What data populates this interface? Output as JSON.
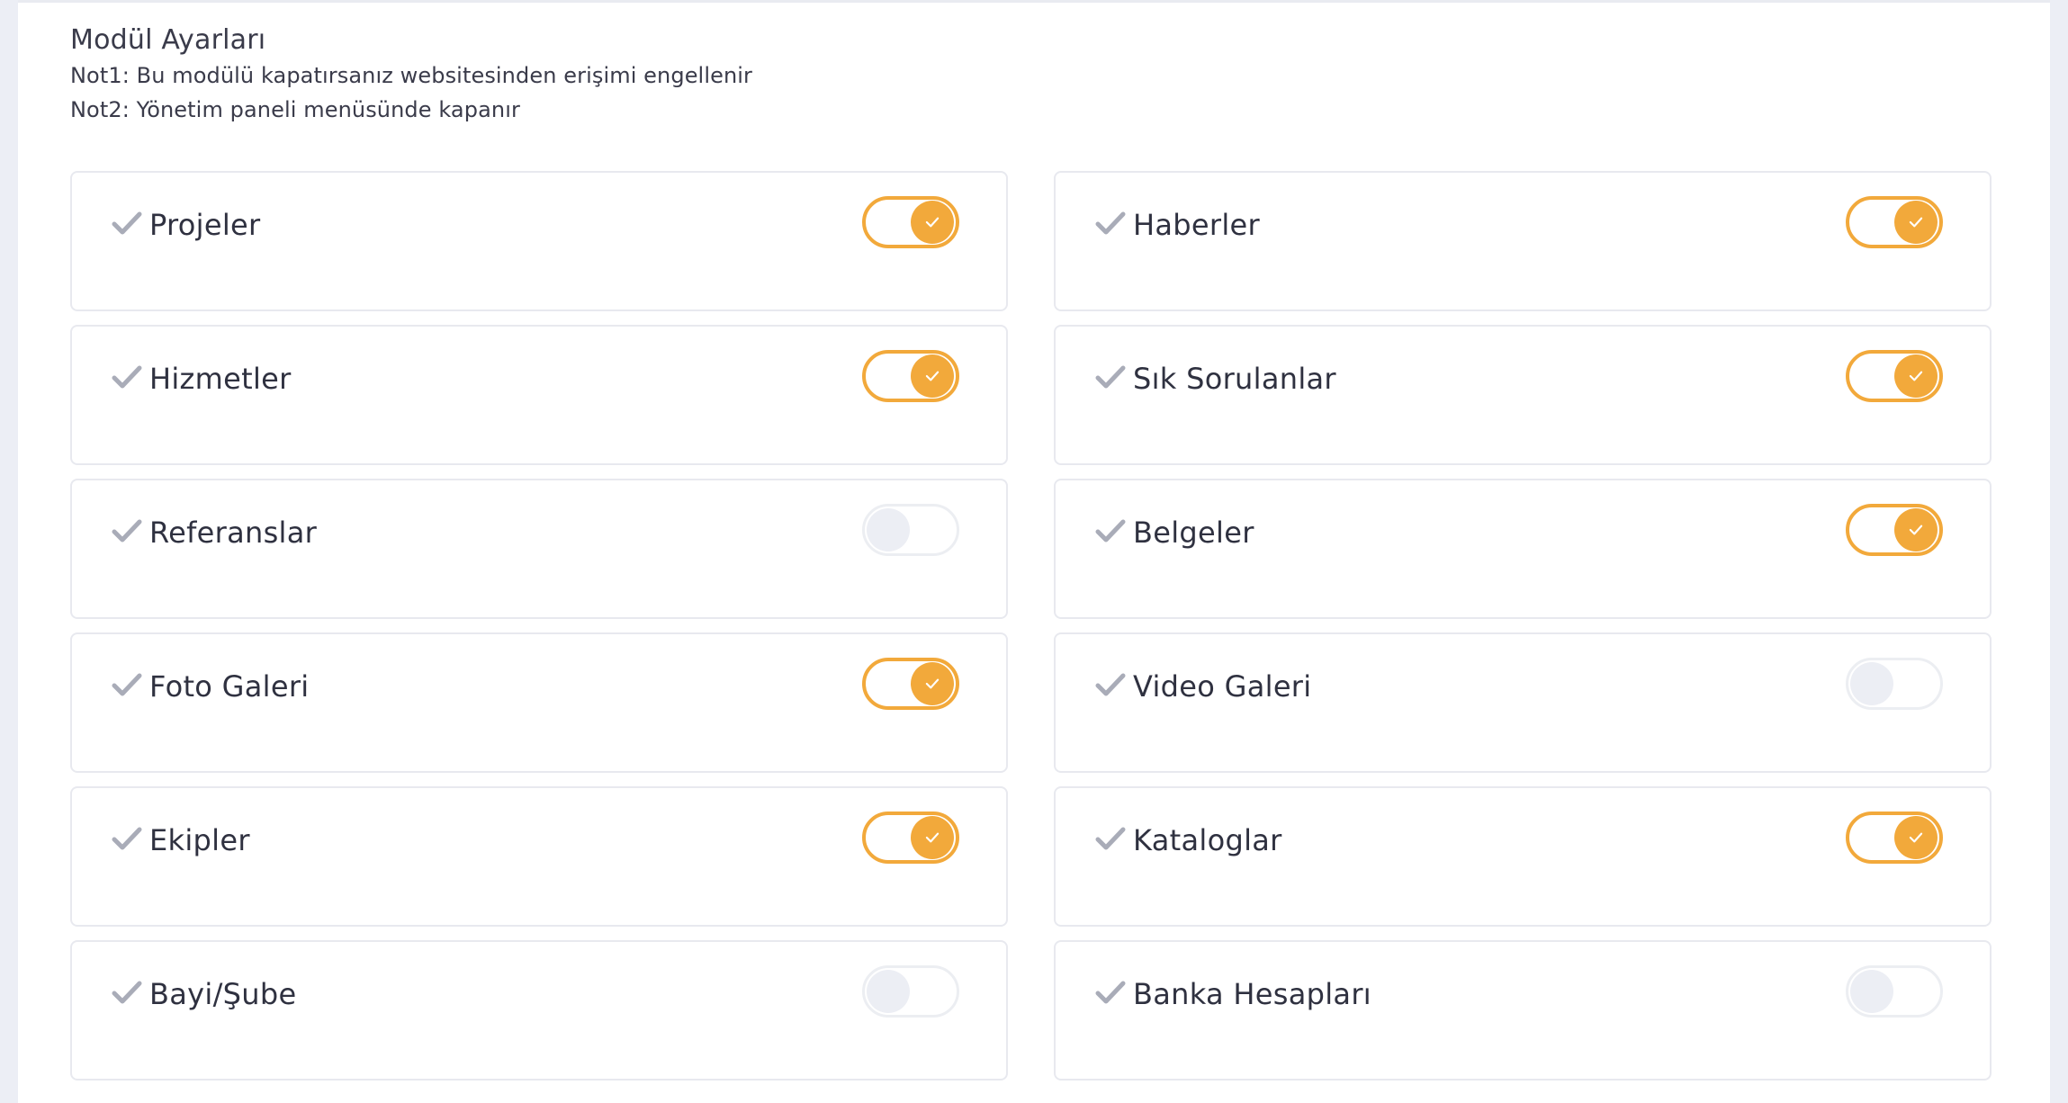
{
  "header": {
    "title": "Modül Ayarları",
    "note1": "Not1: Bu modülü kapatırsanız websitesinden erişimi engellenir",
    "note2": "Not2: Yönetim paneli menüsünde kapanır"
  },
  "colors": {
    "accent": "#f2a93b",
    "toggle_off": "#eceef4",
    "check_gray": "#a9acb8"
  },
  "icons": {
    "module": "check-icon",
    "toggle_on": "check-icon"
  },
  "modules": [
    {
      "label": "Projeler",
      "enabled": true
    },
    {
      "label": "Haberler",
      "enabled": true
    },
    {
      "label": "Hizmetler",
      "enabled": true
    },
    {
      "label": "Sık Sorulanlar",
      "enabled": true
    },
    {
      "label": "Referanslar",
      "enabled": false
    },
    {
      "label": "Belgeler",
      "enabled": true
    },
    {
      "label": "Foto Galeri",
      "enabled": true
    },
    {
      "label": "Video Galeri",
      "enabled": false
    },
    {
      "label": "Ekipler",
      "enabled": true
    },
    {
      "label": "Kataloglar",
      "enabled": true
    },
    {
      "label": "Bayi/Şube",
      "enabled": false
    },
    {
      "label": "Banka Hesapları",
      "enabled": false
    }
  ]
}
